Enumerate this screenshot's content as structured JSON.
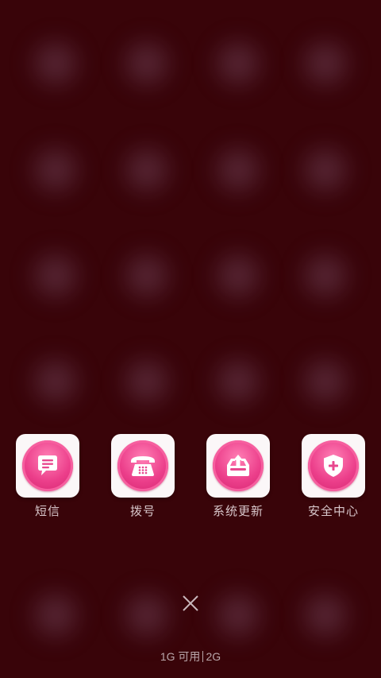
{
  "quick_apps": [
    {
      "label": "短信",
      "icon": "message-icon"
    },
    {
      "label": "拨号",
      "icon": "phone-icon"
    },
    {
      "label": "系统更新",
      "icon": "system-update-icon"
    },
    {
      "label": "安全中心",
      "icon": "shield-icon"
    }
  ],
  "recents": {
    "close_icon": "close-icon",
    "memory_available": "1G 可用",
    "memory_total": "2G"
  },
  "colors": {
    "background": "#3c050a",
    "accent": "#ec3f8b",
    "label": "#d8c7cb"
  }
}
